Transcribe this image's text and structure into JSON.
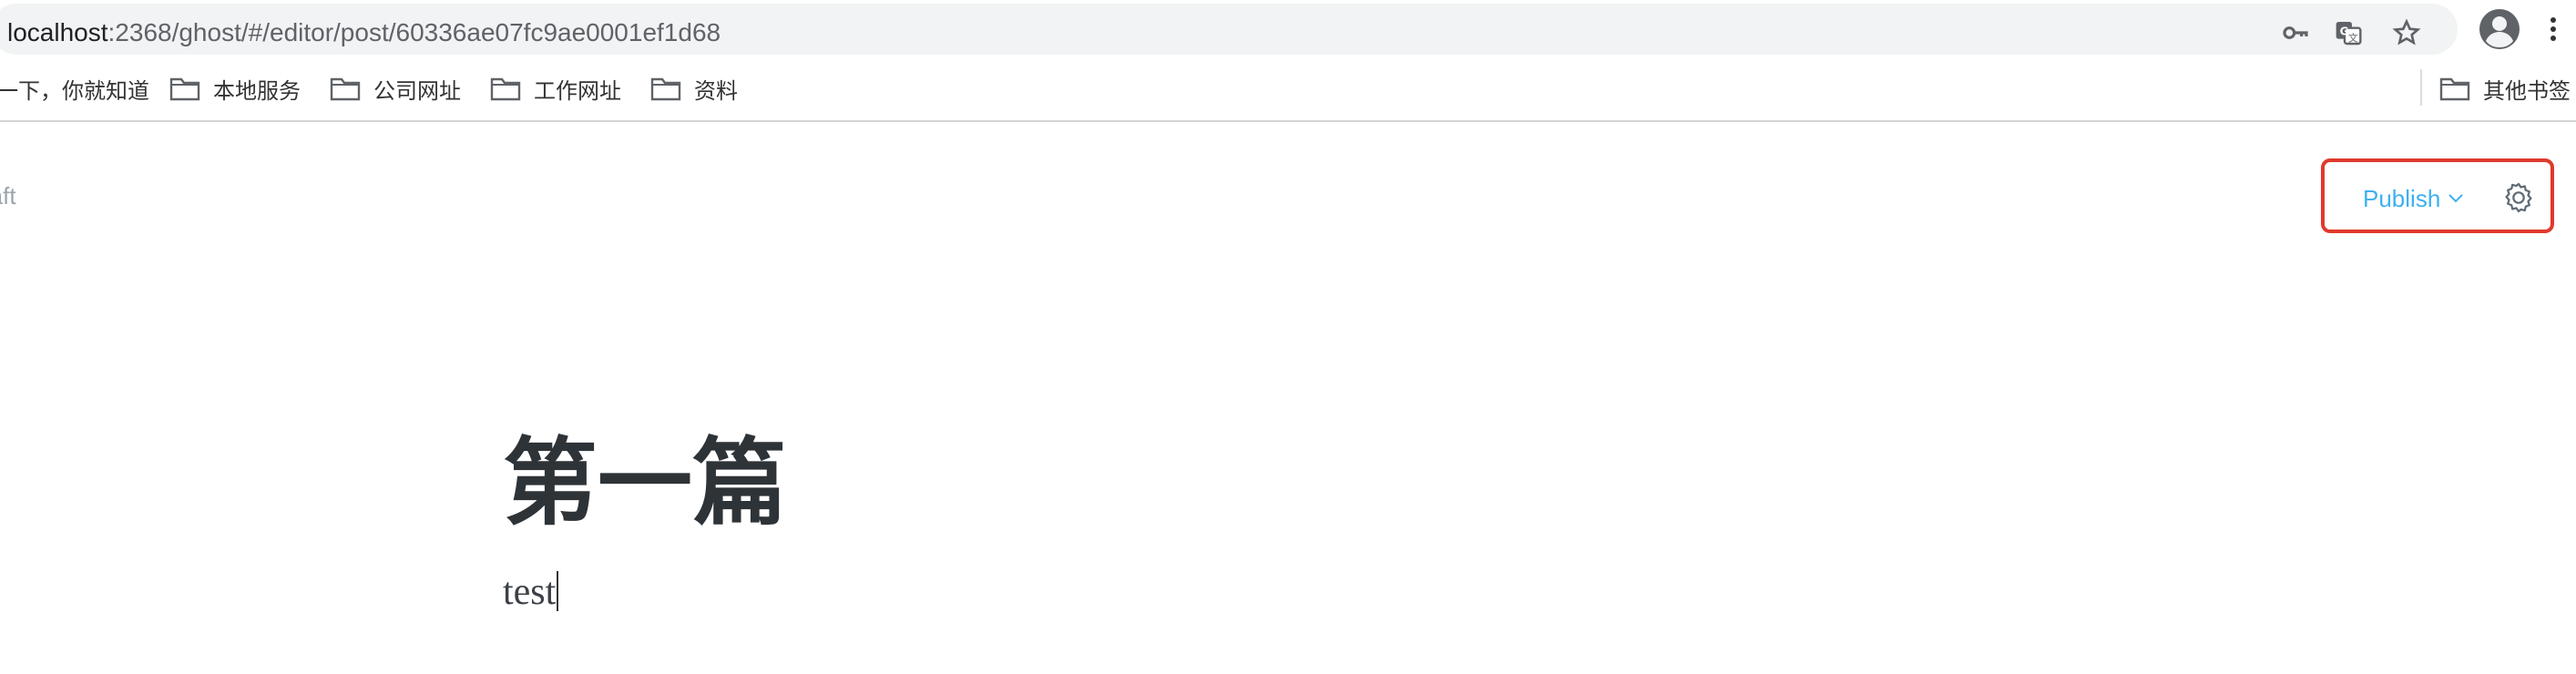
{
  "browser": {
    "url_host": "localhost",
    "url_rest": ":2368/ghost/#/editor/post/60336ae07fc9ae0001ef1d68",
    "icons": [
      "key-icon",
      "translate-icon",
      "star-icon",
      "account-icon",
      "more-icon"
    ]
  },
  "bookmarks": {
    "items": [
      {
        "label": "一下，你就知道",
        "icon": "none"
      },
      {
        "label": "本地服务",
        "icon": "folder-icon"
      },
      {
        "label": "公司网址",
        "icon": "folder-icon"
      },
      {
        "label": "工作网址",
        "icon": "folder-icon"
      },
      {
        "label": "资料",
        "icon": "folder-icon"
      }
    ],
    "other": "其他书签"
  },
  "editor": {
    "status": "raft",
    "publish_label": "Publish",
    "accent_color": "#3eb0ef",
    "highlight_color": "#e0392c"
  },
  "post": {
    "title": "第一篇",
    "body": "test"
  }
}
